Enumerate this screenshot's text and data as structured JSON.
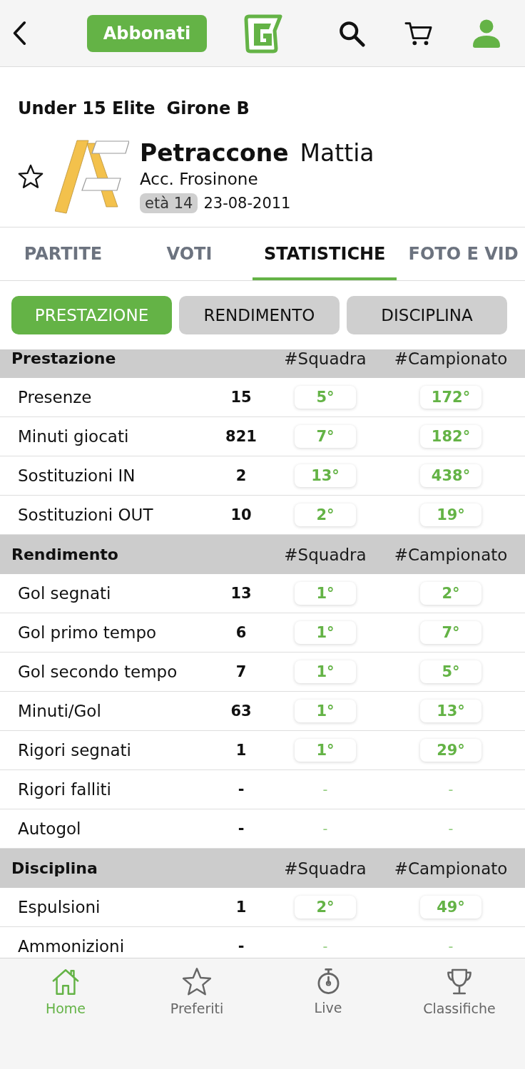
{
  "top_bar": {
    "subscribe_button": "Abbonati"
  },
  "header": {
    "competition": "Under 15 Elite",
    "group": "Girone B",
    "player": {
      "surname": "Petraccone",
      "name": "Mattia",
      "club": "Acc. Frosinone",
      "age": "età 14",
      "birth_date": "23-08-2011",
      "favorite": false
    }
  },
  "tabs": [
    {
      "label": "PARTITE",
      "selected": false
    },
    {
      "label": "VOTI",
      "selected": false
    },
    {
      "label": "STATISTICHE",
      "selected": true
    },
    {
      "label": "FOTO E VID",
      "selected": false
    }
  ],
  "segments": [
    {
      "label": "PRESTAZIONE",
      "selected": true
    },
    {
      "label": "RENDIMENTO",
      "selected": false
    },
    {
      "label": "DISCIPLINA",
      "selected": false
    }
  ],
  "sections": [
    {
      "title": "Prestazione",
      "columns": [
        "#Squadra",
        "#Campionato"
      ],
      "rows": [
        {
          "label": "Presenze",
          "value": "15",
          "kind": "ranked",
          "team_rank": "5°",
          "league_rank": "172°"
        },
        {
          "label": "Minuti giocati",
          "value": "821",
          "kind": "ranked",
          "team_rank": "7°",
          "league_rank": "182°"
        },
        {
          "label": "Sostituzioni IN",
          "value": "2",
          "kind": "ranked",
          "team_rank": "13°",
          "league_rank": "438°"
        },
        {
          "label": "Sostituzioni OUT",
          "value": "10",
          "kind": "ranked",
          "team_rank": "2°",
          "league_rank": "19°"
        }
      ]
    },
    {
      "title": "Rendimento",
      "columns": [
        "#Squadra",
        "#Campionato"
      ],
      "rows": [
        {
          "label": "Gol segnati",
          "value": "13",
          "kind": "ranked",
          "team_rank": "1°",
          "league_rank": "2°"
        },
        {
          "label": "Gol primo tempo",
          "value": "6",
          "kind": "ranked",
          "team_rank": "1°",
          "league_rank": "7°"
        },
        {
          "label": "Gol secondo tempo",
          "value": "7",
          "kind": "ranked",
          "team_rank": "1°",
          "league_rank": "5°"
        },
        {
          "label": "Minuti/Gol",
          "value": "63",
          "kind": "ranked",
          "team_rank": "1°",
          "league_rank": "13°"
        },
        {
          "label": "Rigori segnati",
          "value": "1",
          "kind": "ranked",
          "team_rank": "1°",
          "league_rank": "29°"
        },
        {
          "label": "Rigori falliti",
          "value": "-",
          "kind": "unranked",
          "team_rank": "-",
          "league_rank": "-"
        },
        {
          "label": "Autogol",
          "value": "-",
          "kind": "unranked",
          "team_rank": "-",
          "league_rank": "-"
        }
      ]
    },
    {
      "title": "Disciplina",
      "columns": [
        "#Squadra",
        "#Campionato"
      ],
      "rows": [
        {
          "label": "Espulsioni",
          "value": "1",
          "kind": "ranked",
          "team_rank": "2°",
          "league_rank": "49°"
        },
        {
          "label": "Ammonizioni",
          "value": "-",
          "kind": "unranked",
          "team_rank": "-",
          "league_rank": "-"
        }
      ]
    }
  ],
  "bottom_nav": [
    {
      "label": "Home",
      "kind": "home",
      "selected": true
    },
    {
      "label": "Preferiti",
      "kind": "favorites",
      "selected": false
    },
    {
      "label": "Live",
      "kind": "live",
      "selected": false
    },
    {
      "label": "Classifiche",
      "kind": "rankings",
      "selected": false
    }
  ]
}
